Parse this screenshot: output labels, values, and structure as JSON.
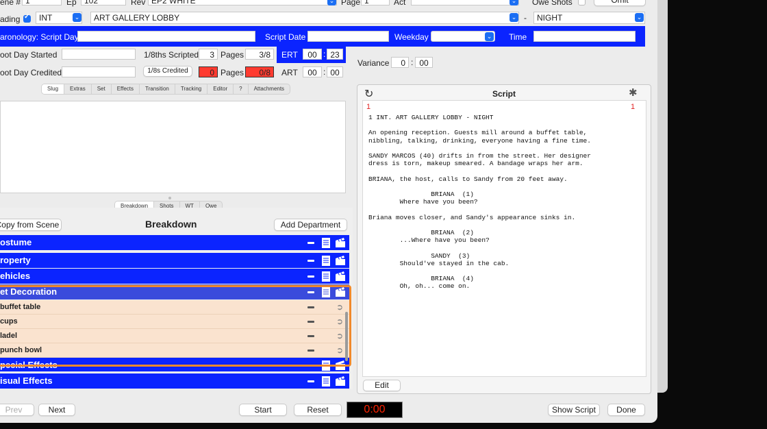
{
  "header": {
    "scene_label": "ene #",
    "scene_value": "1",
    "ep_label": "Ep",
    "ep_value": "102",
    "rev_label": "Rev",
    "rev_value": "EP2 WHITE",
    "page_label": "Page",
    "page_value": "1",
    "act_label": "Act",
    "act_value": "",
    "owe_shots_label": "Owe Shots",
    "omit_button": "Omit",
    "heading_label": "ading",
    "int_ext_value": "INT",
    "location_value": "ART GALLERY LOBBY",
    "dash": "-",
    "time_of_day_value": "NIGHT"
  },
  "chronology": {
    "label": "aronology:  Script Day",
    "script_day_value": "",
    "script_date_label": "Script Date",
    "script_date_value": "",
    "weekday_label": "Weekday",
    "weekday_value": "",
    "time_label": "Time",
    "time_value": ""
  },
  "timing": {
    "shoot_day_started_label": "oot Day Started",
    "shoot_day_started_value": "",
    "eighths_scripted_label": "1/8ths Scripted",
    "eighths_scripted_value": "3",
    "pages_label": "Pages",
    "pages_scripted_value": "3/8",
    "ert_label": "ERT",
    "ert_min": "00",
    "ert_sec": "23",
    "shoot_day_credited_label": "oot Day Credited",
    "shoot_day_credited_value": "",
    "eighths_credited_button": "1/8s Credited",
    "eighths_credited_value": "0",
    "pages_credited_label": "Pages",
    "pages_credited_value": "0/8",
    "art_label": "ART",
    "art_min": "00",
    "art_sec": "00",
    "variance_label": "Variance",
    "variance_min": "0",
    "variance_sec": "00",
    "colon": ":"
  },
  "top_tabs": [
    "Slug",
    "Extras",
    "Set",
    "Effects",
    "Transition",
    "Tracking",
    "Editor",
    "?",
    "Attachments"
  ],
  "bottom_tabs": [
    "Breakdown",
    "Shots",
    "WT",
    "Owe"
  ],
  "breakdown": {
    "copy_button": "Copy from Scene",
    "title": "Breakdown",
    "add_department_button": "Add Department",
    "departments": [
      {
        "name": "ostume"
      },
      {
        "name": "roperty"
      },
      {
        "name": "ehicles"
      },
      {
        "name": "et Decoration"
      },
      {
        "name": "pecial Effects"
      },
      {
        "name": "isual Effects"
      }
    ],
    "set_decoration_items": [
      "buffet table",
      "cups",
      "ladel",
      "punch bowl"
    ]
  },
  "script": {
    "title": "Script",
    "page_left": "1",
    "page_right": "1",
    "lines": [
      "1 INT. ART GALLERY LOBBY - NIGHT",
      "",
      "An opening reception. Guests mill around a buffet table,",
      "nibbling, talking, drinking, everyone having a fine time.",
      "",
      "SANDY MARCOS (40) drifts in from the street. Her designer",
      "dress is torn, makeup smeared. A bandage wraps her arm.",
      "",
      "BRIANA, the host, calls to Sandy from 20 feet away.",
      "",
      "                BRIANA  (1)",
      "        Where have you been?",
      "",
      "Briana moves closer, and Sandy's appearance sinks in.",
      "",
      "                BRIANA  (2)",
      "        ...Where have you been?",
      "",
      "                SANDY  (3)",
      "        Should've stayed in the cab.",
      "",
      "                BRIANA  (4)",
      "        Oh, oh... come on."
    ],
    "edit_button": "Edit"
  },
  "footer": {
    "prev_button": "Prev",
    "next_button": "Next",
    "start_button": "Start",
    "reset_button": "Reset",
    "timer_value": "0:00",
    "show_script_button": "Show Script",
    "done_button": "Done"
  },
  "colors": {
    "department_bar": "#0b24ff",
    "item_row": "#fae3cf",
    "highlight_outline": "#f0892b",
    "timer_text": "#ff2200",
    "credited_fill": "#ff3b30"
  }
}
